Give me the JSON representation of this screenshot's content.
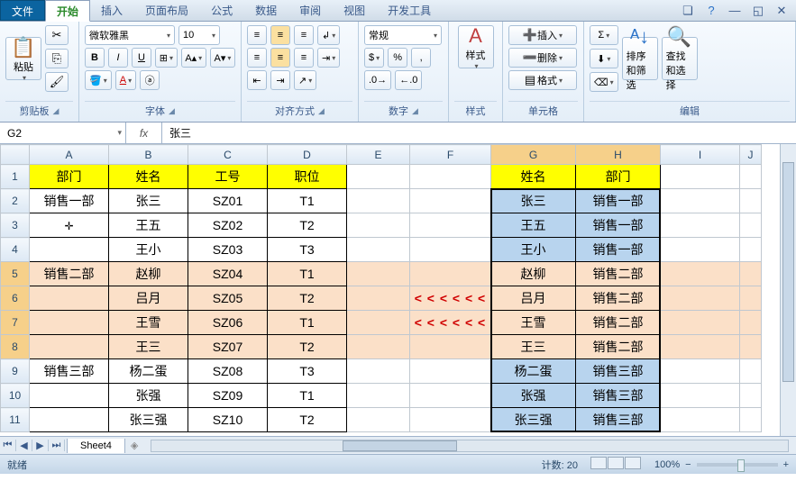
{
  "menu": {
    "file": "文件",
    "tabs": [
      "开始",
      "插入",
      "页面布局",
      "公式",
      "数据",
      "审阅",
      "视图",
      "开发工具"
    ],
    "activeTab": "开始"
  },
  "ribbon": {
    "clipboard": {
      "label": "剪贴板",
      "paste": "粘贴"
    },
    "font": {
      "label": "字体",
      "name": "微软雅黑",
      "size": "10"
    },
    "align": {
      "label": "对齐方式"
    },
    "number": {
      "label": "数字",
      "format": "常规"
    },
    "style": {
      "label": "样式",
      "btn": "样式"
    },
    "cells": {
      "label": "单元格",
      "insert": "插入",
      "delete": "删除",
      "format": "格式"
    },
    "editing": {
      "label": "编辑",
      "sort": "排序和筛选",
      "find": "查找和选择"
    }
  },
  "namebox": "G2",
  "fx_label": "fx",
  "formula": "张三",
  "columns": [
    "A",
    "B",
    "C",
    "D",
    "E",
    "F",
    "G",
    "H",
    "I",
    "J"
  ],
  "rows": [
    "1",
    "2",
    "3",
    "4",
    "5",
    "6",
    "7",
    "8",
    "9",
    "10",
    "11"
  ],
  "headers_left": {
    "A": "部门",
    "B": "姓名",
    "C": "工号",
    "D": "职位"
  },
  "headers_right": {
    "G": "姓名",
    "H": "部门"
  },
  "data_left": [
    {
      "A": "销售一部",
      "B": "张三",
      "C": "SZ01",
      "D": "T1"
    },
    {
      "A": "",
      "B": "王五",
      "C": "SZ02",
      "D": "T2"
    },
    {
      "A": "",
      "B": "王小",
      "C": "SZ03",
      "D": "T3"
    },
    {
      "A": "销售二部",
      "B": "赵柳",
      "C": "SZ04",
      "D": "T1"
    },
    {
      "A": "",
      "B": "吕月",
      "C": "SZ05",
      "D": "T2"
    },
    {
      "A": "",
      "B": "王雪",
      "C": "SZ06",
      "D": "T1"
    },
    {
      "A": "",
      "B": "王三",
      "C": "SZ07",
      "D": "T2"
    },
    {
      "A": "销售三部",
      "B": "杨二蛋",
      "C": "SZ08",
      "D": "T3"
    },
    {
      "A": "",
      "B": "张强",
      "C": "SZ09",
      "D": "T1"
    },
    {
      "A": "",
      "B": "张三强",
      "C": "SZ10",
      "D": "T2"
    }
  ],
  "data_right": [
    {
      "G": "张三",
      "H": "销售一部",
      "shade": "blue"
    },
    {
      "G": "王五",
      "H": "销售一部",
      "shade": "blue"
    },
    {
      "G": "王小",
      "H": "销售一部",
      "shade": "blue"
    },
    {
      "G": "赵柳",
      "H": "销售二部",
      "shade": "gray"
    },
    {
      "G": "吕月",
      "H": "销售二部",
      "shade": "gray"
    },
    {
      "G": "王雪",
      "H": "销售二部",
      "shade": "gray"
    },
    {
      "G": "王三",
      "H": "销售二部",
      "shade": "gray"
    },
    {
      "G": "杨二蛋",
      "H": "销售三部",
      "shade": "blue"
    },
    {
      "G": "张强",
      "H": "销售三部",
      "shade": "blue"
    },
    {
      "G": "张三强",
      "H": "销售三部",
      "shade": "blue"
    }
  ],
  "arrows_rows": [
    6,
    7
  ],
  "arrows_text": "< < < < < <",
  "orange_rows": [
    5,
    6,
    7,
    8
  ],
  "sheet": {
    "name": "Sheet4"
  },
  "status": {
    "ready": "就绪",
    "count_label": "计数:",
    "count": "20",
    "zoom": "100%"
  }
}
